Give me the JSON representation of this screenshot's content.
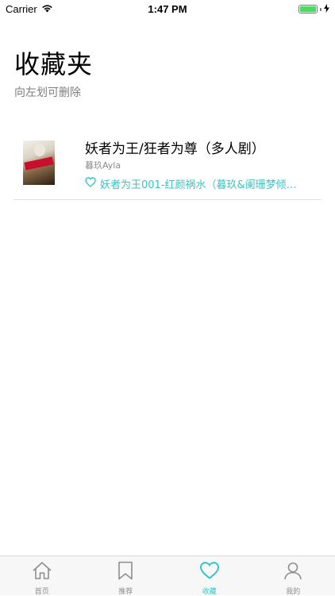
{
  "status_bar": {
    "carrier": "Carrier",
    "time": "1:47 PM",
    "battery_level": 1.0,
    "battery_color": "#4cd964"
  },
  "header": {
    "title": "收藏夹",
    "subtitle": "向左划可删除"
  },
  "favorites": [
    {
      "title": "妖者为王/狂者为尊（多人剧）",
      "author": "暮玖Ayla",
      "episode": "妖者为王001-红颜祸水（暮玖&阑珊梦倾…",
      "episode_icon": "heart-icon"
    }
  ],
  "tab_bar": {
    "accent_color": "#37c5c5",
    "tabs": [
      {
        "label": "首页",
        "icon": "home-icon",
        "active": false
      },
      {
        "label": "推荐",
        "icon": "bookmark-icon",
        "active": false
      },
      {
        "label": "收藏",
        "icon": "heart-icon",
        "active": true
      },
      {
        "label": "我的",
        "icon": "person-icon",
        "active": false
      }
    ]
  }
}
